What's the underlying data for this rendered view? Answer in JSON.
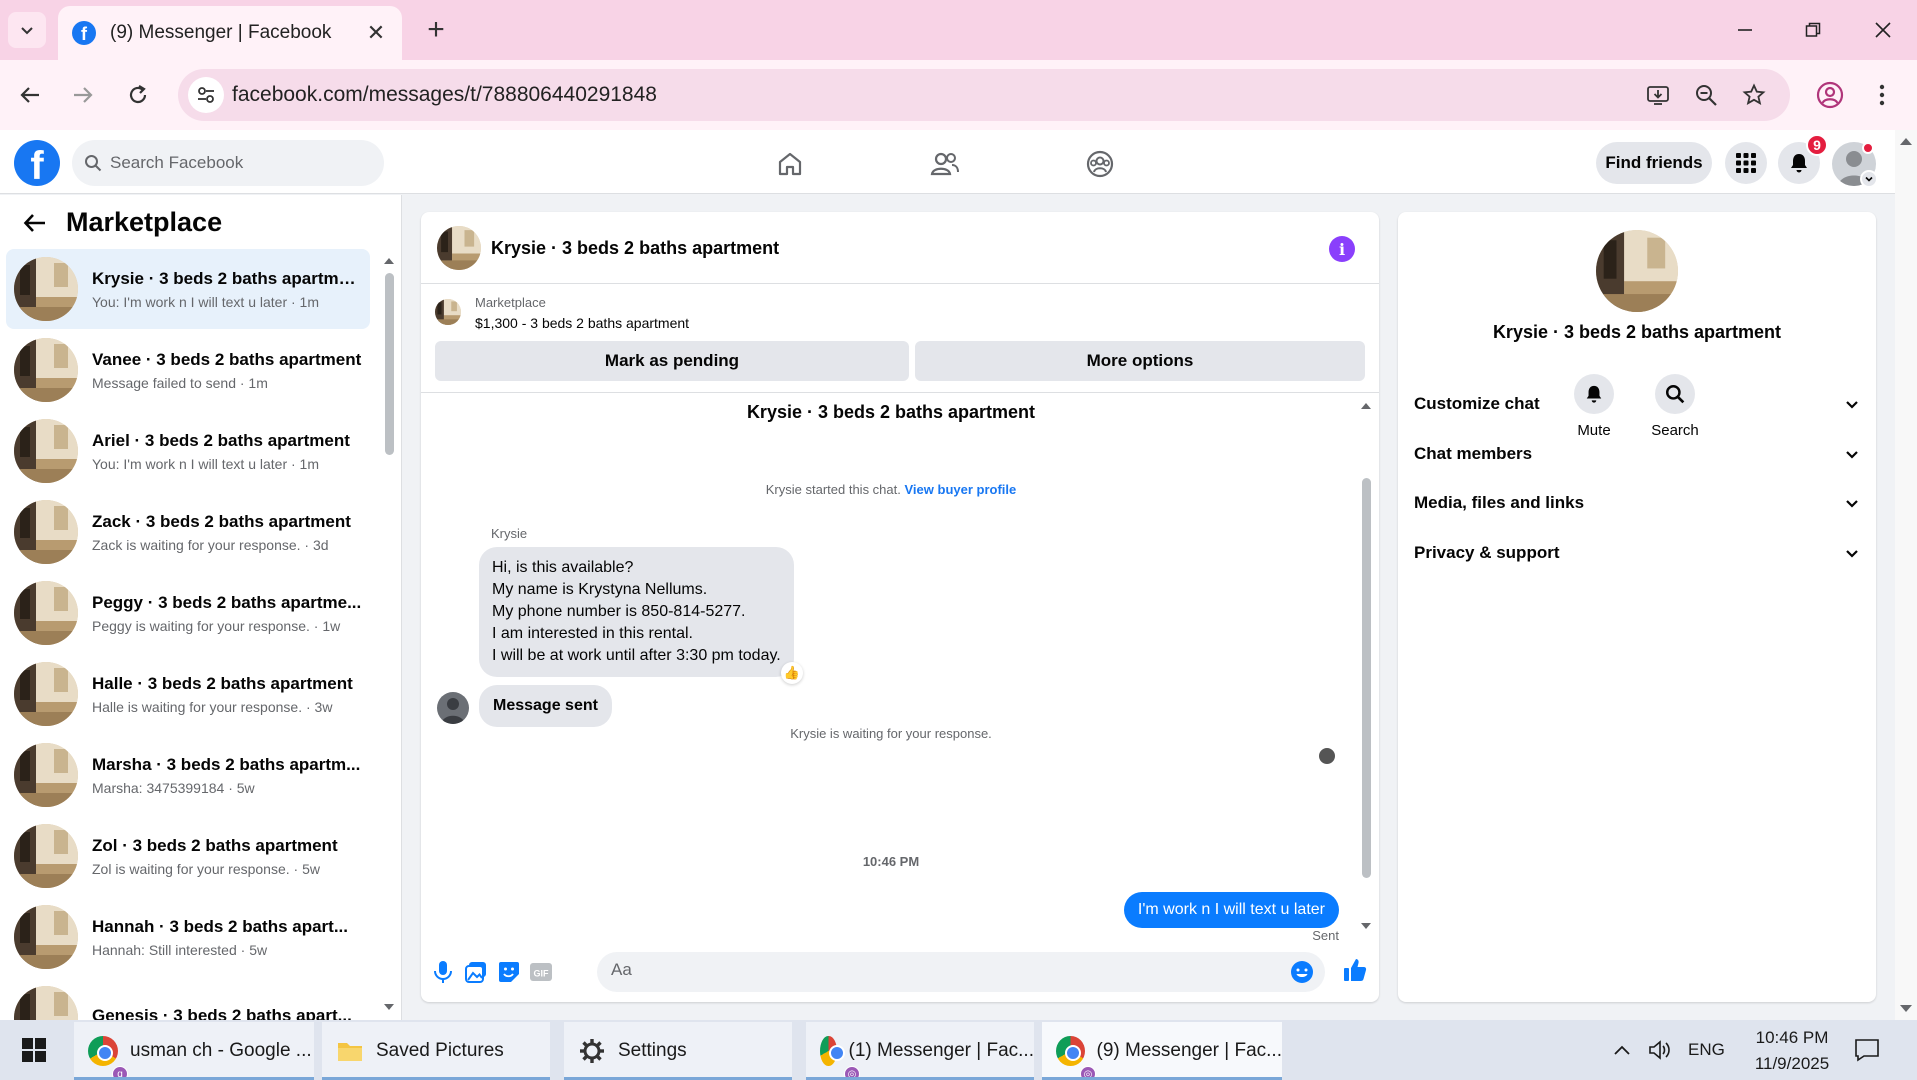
{
  "browser": {
    "tab_title": "(9) Messenger | Facebook",
    "url": "facebook.com/messages/t/788806440291848"
  },
  "fb": {
    "logo_letter": "f",
    "search_placeholder": "Search Facebook",
    "find_friends": "Find friends",
    "notification_count": "9"
  },
  "sidebar": {
    "title": "Marketplace",
    "conversations": [
      {
        "name": "Krysie · 3 beds 2 baths apartment",
        "preview": "You: I'm work n I will text u later · 1m",
        "active": true
      },
      {
        "name": "Vanee · 3 beds 2 baths apartment",
        "preview": "Message failed to send · 1m"
      },
      {
        "name": "Ariel · 3 beds 2 baths apartment",
        "preview": "You: I'm work n I will text u later · 1m"
      },
      {
        "name": "Zack · 3 beds 2 baths apartment",
        "preview": "Zack is waiting for your response. · 3d"
      },
      {
        "name": "Peggy · 3 beds 2 baths apartme...",
        "preview": "Peggy is waiting for your response. · 1w"
      },
      {
        "name": "Halle · 3 beds 2 baths apartment",
        "preview": "Halle is waiting for your response. · 3w"
      },
      {
        "name": "Marsha · 3 beds 2 baths apartm...",
        "preview": "Marsha: 3475399184 · 5w"
      },
      {
        "name": "Zol · 3 beds 2 baths apartment",
        "preview": "Zol is waiting for your response. · 5w"
      },
      {
        "name": "Hannah · 3 beds 2 baths apart...",
        "preview": "Hannah: Still interested · 5w"
      },
      {
        "name": "Genesis · 3 beds 2 baths apart...",
        "preview": ""
      }
    ]
  },
  "chat": {
    "header_name": "Krysie · 3 beds 2 baths apartment",
    "marketplace_label": "Marketplace",
    "listing": "$1,300 - 3 beds 2 baths apartment",
    "mark_pending": "Mark as pending",
    "more_options": "More options",
    "thread_title": "Krysie · 3 beds 2 baths apartment",
    "started_text": "Krysie started this chat.",
    "view_buyer_profile": "View buyer profile",
    "sender_label": "Krysie",
    "incoming_lines": [
      "Hi, is this available?",
      "My name is Krystyna Nellums.",
      "My phone number is 850-814-5277.",
      "I am interested in this rental.",
      "I will be at work until after 3:30 pm today."
    ],
    "reaction": "👍",
    "auto_message": "Message sent",
    "waiting_text": "Krysie is waiting for your response.",
    "timestamp": "10:46 PM",
    "outgoing": "I'm work n I will text u later",
    "sent_status": "Sent",
    "composer_placeholder": "Aa"
  },
  "info": {
    "name": "Krysie · 3 beds 2 baths apartment",
    "mute": "Mute",
    "search": "Search",
    "sections": [
      "Customize chat",
      "Chat members",
      "Media, files and links",
      "Privacy & support"
    ]
  },
  "taskbar": {
    "items": [
      {
        "label": "usman ch - Google ...",
        "icon": "chrome-icon"
      },
      {
        "label": "Saved Pictures",
        "icon": "folder-icon"
      },
      {
        "label": "Settings",
        "icon": "gear-icon"
      },
      {
        "label": "(1) Messenger | Fac...",
        "icon": "chrome-icon"
      },
      {
        "label": "(9) Messenger | Fac...",
        "icon": "chrome-icon"
      }
    ],
    "language": "ENG",
    "time": "10:46 PM",
    "date": "11/9/2025"
  },
  "colors": {
    "accent": "#1877f2",
    "outgoing_bubble": "#0a7cff",
    "tabstrip": "#f8d3e6",
    "info_purple": "#8a3ffc"
  }
}
